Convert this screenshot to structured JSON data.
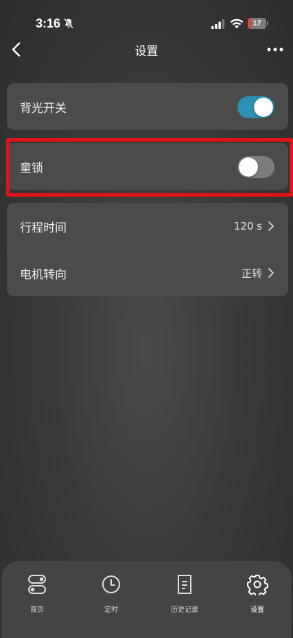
{
  "status_bar": {
    "time": "3:16",
    "battery_level": "17",
    "battery_fraction": 0.17
  },
  "nav": {
    "title": "设置"
  },
  "settings": {
    "backlight": {
      "label": "背光开关",
      "enabled": true
    },
    "child_lock": {
      "label": "童锁",
      "enabled": false
    },
    "travel_time": {
      "label": "行程时间",
      "value": "120 s"
    },
    "motor_direction": {
      "label": "电机转向",
      "value": "正转"
    }
  },
  "tabs": [
    {
      "label": "首页",
      "icon": "toggles-icon"
    },
    {
      "label": "定时",
      "icon": "clock-icon"
    },
    {
      "label": "历史记录",
      "icon": "document-icon"
    },
    {
      "label": "设置",
      "icon": "gear-icon"
    }
  ],
  "colors": {
    "toggle_on": "#2a91b3",
    "toggle_off": "#7c7c7c",
    "highlight": "#e0141a",
    "battery_low": "#e0453a"
  }
}
